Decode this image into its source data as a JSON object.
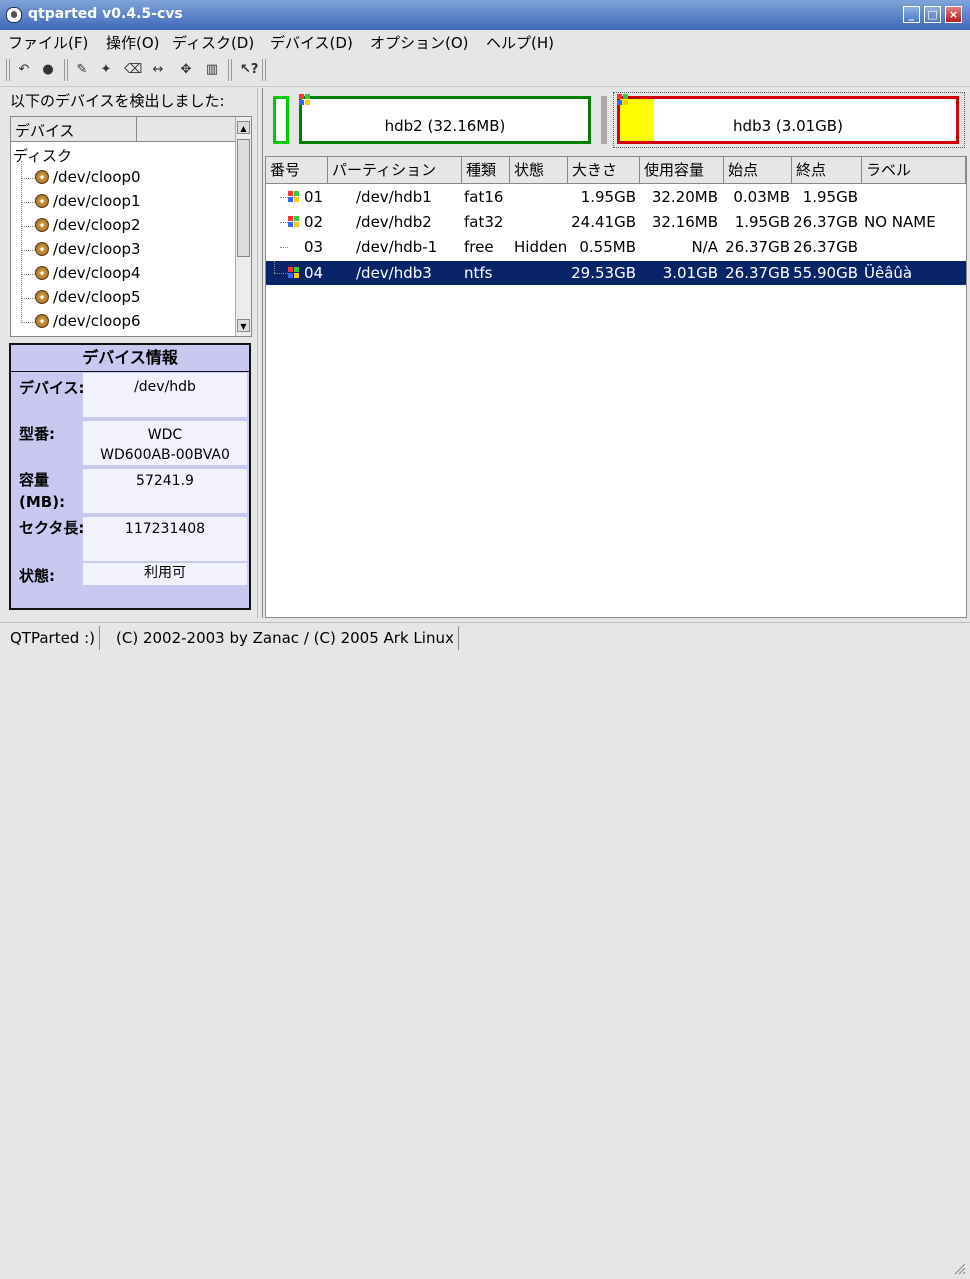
{
  "window": {
    "title": "qtparted v0.4.5-cvs"
  },
  "menu": [
    "ファイル(F)",
    "操作(O)",
    "ディスク(D)",
    "デバイス(D)",
    "オプション(O)",
    "ヘルプ(H)"
  ],
  "left": {
    "detected_label": "以下のデバイスを検出しました:",
    "tree_header": "デバイス",
    "tree_root": "ディスク",
    "devices": [
      "/dev/cloop0",
      "/dev/cloop1",
      "/dev/cloop2",
      "/dev/cloop3",
      "/dev/cloop4",
      "/dev/cloop5",
      "/dev/cloop6"
    ]
  },
  "device_info": {
    "title": "デバイス情報",
    "device_label": "デバイス:",
    "device_value": "/dev/hdb",
    "model_label": "型番:",
    "model_value_line1": "WDC",
    "model_value_line2": "WD600AB-00BVA0",
    "capacity_label": "容量 (MB):",
    "capacity_value": "57241.9",
    "sector_label": "セクタ長:",
    "sector_value": "117231408",
    "status_label": "状態:",
    "status_value": "利用可"
  },
  "map": {
    "hdb2_label": "hdb2 (32.16MB)",
    "hdb3_label": "hdb3 (3.01GB)",
    "hdb3_used_fraction": 0.1
  },
  "table": {
    "columns": [
      "番号",
      "パーティション",
      "種類",
      "状態",
      "大きさ",
      "使用容量",
      "始点",
      "終点",
      "ラベル"
    ],
    "rows": [
      {
        "num": "01",
        "partition": "/dev/hdb1",
        "type": "fat16",
        "state": "",
        "size": "1.95GB",
        "used": "32.20MB",
        "start": "0.03MB",
        "end": "1.95GB",
        "label": ""
      },
      {
        "num": "02",
        "partition": "/dev/hdb2",
        "type": "fat32",
        "state": "",
        "size": "24.41GB",
        "used": "32.16MB",
        "start": "1.95GB",
        "end": "26.37GB",
        "label": "NO NAME"
      },
      {
        "num": "03",
        "partition": "/dev/hdb-1",
        "type": "free",
        "state": "Hidden",
        "size": "0.55MB",
        "used": "N/A",
        "start": "26.37GB",
        "end": "26.37GB",
        "label": ""
      },
      {
        "num": "04",
        "partition": "/dev/hdb3",
        "type": "ntfs",
        "state": "",
        "size": "29.53GB",
        "used": "3.01GB",
        "start": "26.37GB",
        "end": "55.90GB",
        "label": "Üêâûà"
      }
    ]
  },
  "status": {
    "app": "QTParted :)",
    "copyright": "(C) 2002-2003 by Zanac / (C) 2005 Ark Linux"
  },
  "icons": [
    "qtparted-app-icon",
    "undo-icon",
    "commit-icon",
    "wrench-icon",
    "format-icon",
    "eraser-icon",
    "resize-icon",
    "move-icon",
    "trash-icon",
    "whats-this-icon",
    "disk-icon",
    "windows-partition-icon"
  ],
  "colors": {
    "selection": "#0a246a",
    "hdb2_border": "#008000",
    "hdb3_border": "#d00000",
    "used_space": "#ffff00",
    "free_border": "#00cc00",
    "info_bg": "#c8c8f0",
    "titlebar": "#4f78c4"
  }
}
